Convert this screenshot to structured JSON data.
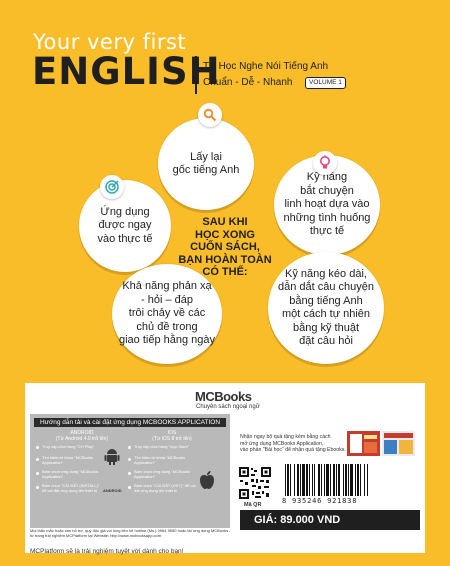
{
  "header": {
    "small": "Your very first",
    "big": "ENGLISH",
    "sub1": "Tự Học Nghe Nói Tiếng Anh",
    "sub2": "Chuẩn - Dễ - Nhanh",
    "volume": "VOLUME 1"
  },
  "center_lines": [
    "SAU KHI",
    "HỌC XONG",
    "CUỐN SÁCH,",
    "BẠN HOÀN TOÀN",
    "CÓ THỂ:"
  ],
  "bubbles": {
    "b1": [
      "Lấy lại",
      "gốc tiếng Anh"
    ],
    "b2": [
      "Ứng dụng",
      "được ngay",
      "vào thực tế"
    ],
    "b3": [
      "Kỹ năng",
      "bắt chuyện",
      "linh hoạt dựa vào",
      "những tình huống",
      "thực tế"
    ],
    "b4": [
      "Kỹ năng kéo dài,",
      "dẫn dắt câu chuyện",
      "bằng tiếng Anh",
      "một cách tự nhiên",
      "bằng kỹ thuật",
      "đặt câu hỏi"
    ],
    "b5": [
      "Khả năng phản xạ",
      "- hỏi – đáp",
      "trôi chảy về các",
      "chủ đề trong",
      "giao tiếp hằng ngày"
    ]
  },
  "icons": {
    "b1": "magnifier-icon",
    "b2": "target-icon",
    "b3": "lightbulb-icon"
  },
  "publisher": {
    "logo": "MCBooks",
    "tagline": "Chuyên sách ngoại ngữ"
  },
  "app_box": {
    "title": "Hướng dẫn tải và cài đặt ứng dụng MCBOOKS APPLICATION",
    "android": {
      "head": [
        "ANDROID",
        "(Từ Android 4.0 trở lên)"
      ],
      "steps": [
        "Truy cập cửa hàng \"CH Play\"",
        "Tìm kiếm từ khóa \"MCBooks Application\"",
        "Bấm chọn ứng dụng \"MCBooks Application\"",
        "Bấm chọn \"CÀI ĐẶT (INSTALL)\" để cài đặt ứng dụng lên thiết bị"
      ],
      "logo": "ANDROID"
    },
    "ios": {
      "head": [
        "IOS",
        "(Từ iOS 8 trở lên)"
      ],
      "steps": [
        "Truy cập cửa hàng \"App Store\"",
        "Tìm kiếm từ khóa \"MCBooks Application\"",
        "Bấm chọn ứng dụng \"MCBooks Application\"",
        "Bấm chọn \"CÀI ĐẶT (GET)\" để cài đặt ứng dụng lên thiết bị"
      ]
    },
    "footer": [
      "Mọi thắc mắc hoặc cần hỗ trợ, quý độc giả vui lòng liên hệ hotline (Ms.) 0964 9550 hoặc tải ứng dụng MCBooks Application và sử dụng",
      "từ trang trái nghiệm MCPlatform tại Website: http://www.mcbooksapp.com"
    ]
  },
  "promo": [
    "Nhận ngay bộ quà tặng kèm bằng cách",
    "mở ứng dụng MCBooks Application,",
    "vào phần \"Bài học\" để nhận quà tặng Ebooks."
  ],
  "qr_label": "Mã QR",
  "barcode_number": "8 935246 921838",
  "price": "GIÁ: 89.000 VND",
  "mcplatform": "MCPlatform sẽ là trải nghiệm tuyệt vời dành cho bạn!"
}
